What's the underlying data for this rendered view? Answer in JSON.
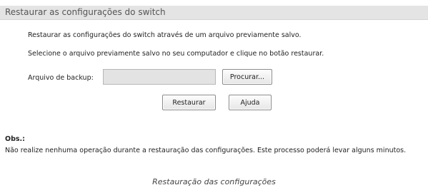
{
  "panel": {
    "title": "Restaurar as configurações do switch",
    "line1": "Restaurar as configurações do switch através de um arquivo previamente salvo.",
    "line2": "Selecione o arquivo previamente salvo no seu computador e clique no botão restaurar.",
    "backup_label": "Arquivo de backup:",
    "backup_value": "",
    "browse_label": "Procurar...",
    "restore_label": "Restaurar",
    "help_label": "Ajuda"
  },
  "note": {
    "title": "Obs.:",
    "text": "Não realize nenhuma operação durante a restauração das configurações. Este processo poderá levar alguns minutos."
  },
  "caption": "Restauração das configurações",
  "colors": {
    "header_bg": "#e4e4e4",
    "input_bg": "#e3e3e3"
  }
}
